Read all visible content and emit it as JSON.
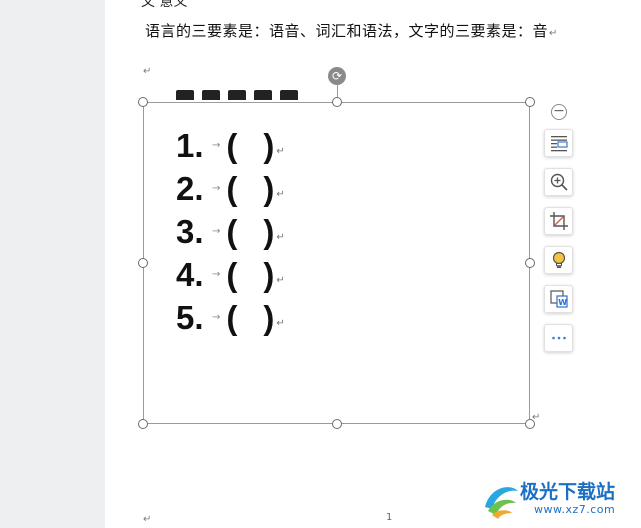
{
  "document": {
    "top_cut_text": "文 意义",
    "body_line": "语言的三要素是：语音、词汇和语法，文字的三要素是：音",
    "paragraph_mark": "↵",
    "page_number": "1"
  },
  "image": {
    "list": [
      {
        "num": "1.",
        "open": "(",
        "close": ")"
      },
      {
        "num": "2.",
        "open": "(",
        "close": ")"
      },
      {
        "num": "3.",
        "open": "(",
        "close": ")"
      },
      {
        "num": "4.",
        "open": "(",
        "close": ")"
      },
      {
        "num": "5.",
        "open": "(",
        "close": ")"
      }
    ],
    "tab_arrow": "→"
  },
  "toolbar": {
    "collapse_glyph": "−",
    "buttons": [
      {
        "name": "text-wrap",
        "icon": "text-wrap-icon"
      },
      {
        "name": "zoom-in",
        "icon": "zoom-in-icon"
      },
      {
        "name": "crop",
        "icon": "crop-icon"
      },
      {
        "name": "smart-suggest",
        "icon": "lightbulb-icon"
      },
      {
        "name": "image-to-word",
        "icon": "image-to-word-icon"
      },
      {
        "name": "more",
        "icon": "more-icon"
      }
    ]
  },
  "watermark": {
    "text": "极光下载站",
    "url": "www.xz7.com"
  }
}
